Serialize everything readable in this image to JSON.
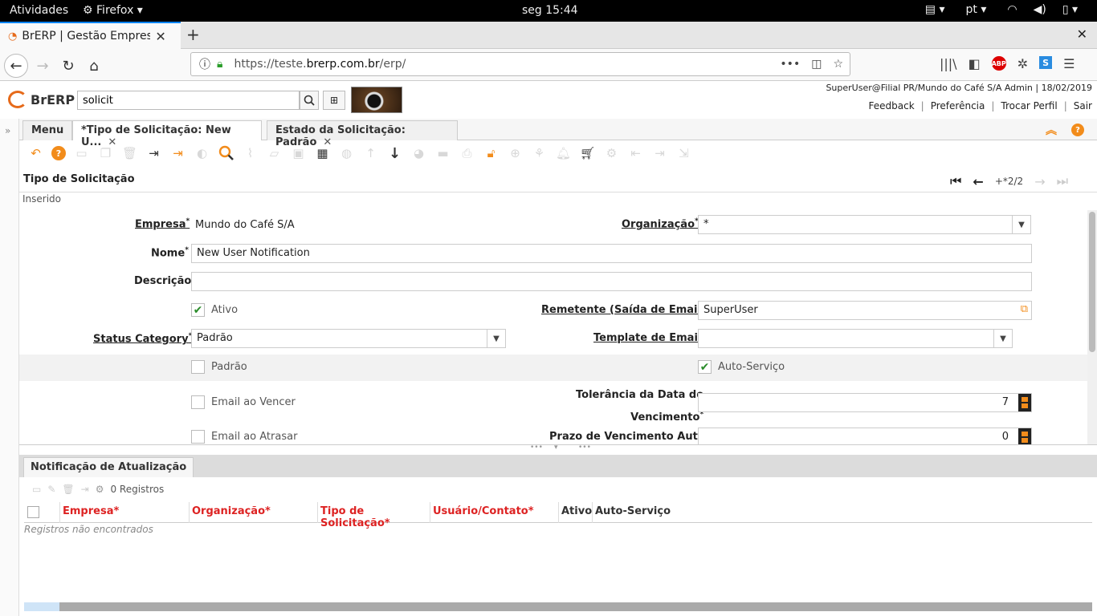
{
  "system_bar": {
    "activities": "Atividades",
    "app": "Firefox",
    "clock": "seg 15:44",
    "lang": "pt"
  },
  "browser": {
    "tab_title": "BrERP | Gestão Empresa",
    "url_prefix": "https://teste.",
    "url_domain": "brerp.com.br",
    "url_path": "/erp/"
  },
  "header": {
    "logo": "BrERP",
    "search_value": "solicit",
    "user_info": "SuperUser@Filial PR/Mundo do Café S/A Admin | 18/02/2019",
    "links": [
      "Feedback",
      "Preferência",
      "Trocar Perfil",
      "Sair"
    ]
  },
  "window_tabs": {
    "menu": "Menu",
    "tab1": "*Tipo de Solicitação: New U...",
    "tab2": "Estado da Solicitação: Padrão"
  },
  "form": {
    "title": "Tipo de Solicitação",
    "record_count": "+*2/2",
    "status": "Inserido",
    "fields": {
      "empresa_label": "Empresa",
      "empresa_value": "Mundo do Café S/A",
      "organizacao_label": "Organização",
      "organizacao_value": "*",
      "nome_label": "Nome",
      "nome_value": "New User Notification",
      "descricao_label": "Descrição",
      "descricao_value": "",
      "ativo_label": "Ativo",
      "ativo_checked": true,
      "remetente_label": "Remetente (Saída de Email)",
      "remetente_value": "SuperUser",
      "status_category_label": "Status Category",
      "status_category_value": "Padrão",
      "template_label": "Template de Email",
      "template_value": "",
      "padrao_label": "Padrão",
      "padrao_checked": false,
      "autoservico_label": "Auto-Serviço",
      "autoservico_checked": true,
      "email_vencer_label": "Email ao Vencer",
      "tolerancia_label_1": "Tolerância da Data do",
      "tolerancia_label_2": "Vencimento",
      "tolerancia_value": "7",
      "email_atrasar_label": "Email ao Atrasar",
      "prazo_label": "Prazo de Vencimento Auto",
      "prazo_value": "0"
    }
  },
  "detail": {
    "tab": "Notificação de Atualização",
    "record_count": "0 Registros",
    "columns": [
      "Empresa*",
      "Organização*",
      "Tipo de Solicitação*",
      "Usuário/Contato*",
      "Ativo",
      "Auto-Serviço"
    ],
    "empty_text": "Registros não encontrados"
  },
  "colors": {
    "accent": "#f28c1b",
    "required_column": "#dd2222",
    "check": "#2a8c2a"
  }
}
